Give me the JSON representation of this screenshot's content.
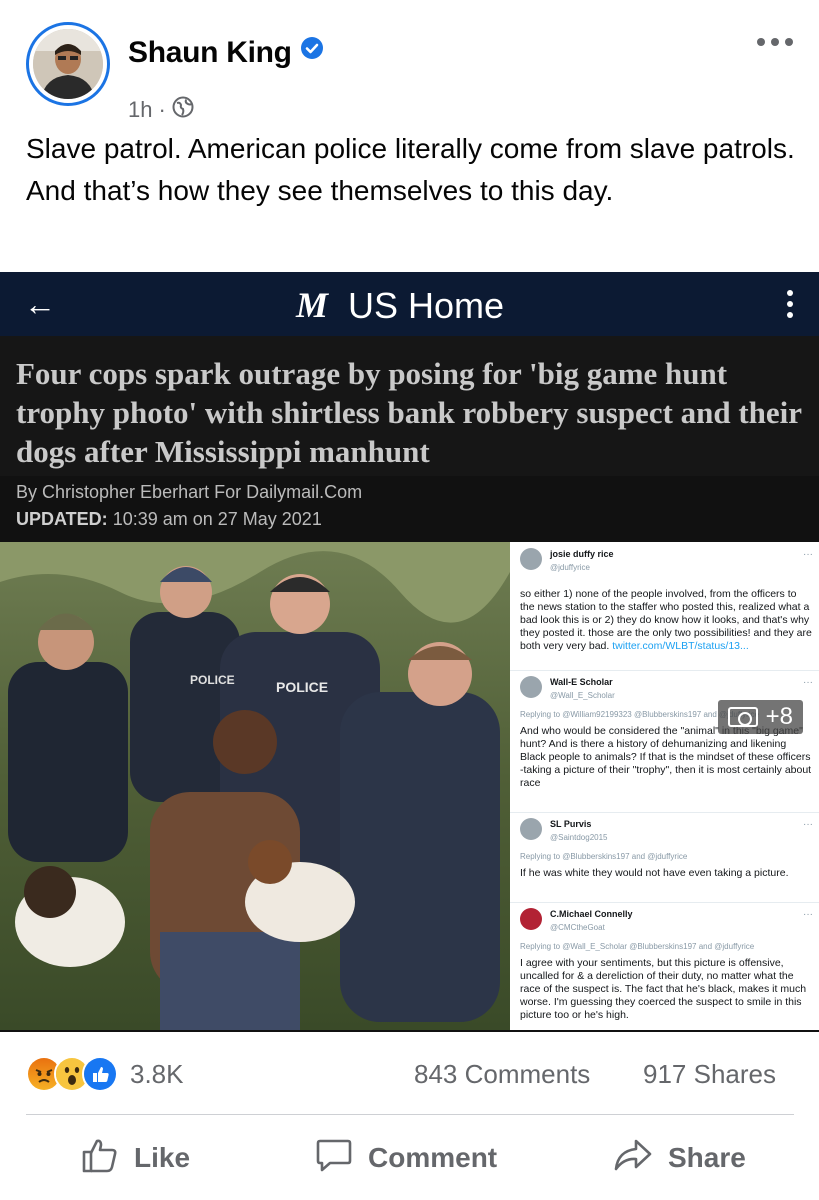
{
  "post": {
    "author": "Shaun King",
    "time": "1h",
    "text": "Slave patrol. American police literally come from slave patrols. And that’s how they see themselves to this day."
  },
  "shared_image": {
    "site_logo": "M",
    "site_section": "US Home",
    "headline": "Four cops spark outrage by posing for 'big game hunt trophy photo' with shirtless bank robbery suspect and their dogs after Mississippi manhunt",
    "byline": "By Christopher Eberhart For Dailymail.Com",
    "updated_label": "UPDATED:",
    "updated_value": "10:39 am on 27 May 2021",
    "vest_label_1": "POLICE",
    "vest_label_2": "POLICE",
    "gallery_count": "+8",
    "tweets": [
      {
        "name": "josie duffy rice",
        "handle": "@jduffyrice",
        "reply": "",
        "body": "so either 1) none of the people involved, from the officers to the news station to the staffer who posted this, realized what a bad look this is or 2) they do know how it looks, and that's why they posted it. those are the only two possibilities! and they are both very very bad.",
        "link": "twitter.com/WLBT/status/13..."
      },
      {
        "name": "Wall-E Scholar",
        "handle": "@Wall_E_Scholar",
        "reply": "Replying to @William92199323 @Blubberskins197 and @jduffyrice",
        "body": "And who would be considered the \"animal\" in this \"big game\" hunt? And is there a history of dehumanizing and likening Black people to animals? If that is the mindset of these officers -taking a picture of their \"trophy\", then it is most certainly about race",
        "link": ""
      },
      {
        "name": "SL Purvis",
        "handle": "@Saintdog2015",
        "reply": "Replying to @Blubberskins197 and @jduffyrice",
        "body": "If he was white they would not have even taking a picture.",
        "link": ""
      },
      {
        "name": "C.Michael Connelly",
        "handle": "@CMCtheGoat",
        "reply": "Replying to @Wall_E_Scholar @Blubberskins197 and @jduffyrice",
        "body": "I agree with your sentiments, but this picture is offensive, uncalled for & a dereliction of their duty, no matter what the race of the suspect is. The fact that he's black, makes it much worse. I'm guessing they coerced the suspect to smile in this picture too or he's high.",
        "link": ""
      }
    ]
  },
  "stats": {
    "reactions": "3.8K",
    "comments": "843 Comments",
    "shares": "917 Shares"
  },
  "actions": {
    "like": "Like",
    "comment": "Comment",
    "share": "Share"
  },
  "colors": {
    "verified": "#1b74e4",
    "dm_bar": "#0c1a33",
    "like_blue": "#1877f2",
    "muted": "#65676b"
  }
}
